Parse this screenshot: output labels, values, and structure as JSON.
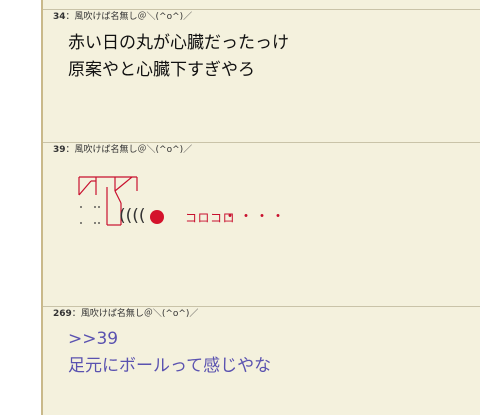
{
  "posts": [
    {
      "number": "34",
      "separator": "：",
      "name": "風吹けば名無し＠＼(^o^)／",
      "lines": [
        "赤い日の丸が心臓だったっけ",
        "原案やと心臓下すぎやろ"
      ]
    },
    {
      "number": "39",
      "separator": "：",
      "name": "風吹けば名無し＠＼(^o^)／",
      "art_parens": "((((",
      "art_roll_text": "コロコロ",
      "art_dots": "・・・・"
    },
    {
      "number": "269",
      "separator": "：",
      "name": "風吹けば名無し＠＼(^o^)／",
      "anchor": ">>39",
      "lines": [
        "足元にボールって感じやな"
      ]
    }
  ],
  "colors": {
    "panel_bg": "#f4f1dd",
    "border": "#c9b98a",
    "accent_red": "#c8102e",
    "link_blue": "#5a52b0"
  }
}
